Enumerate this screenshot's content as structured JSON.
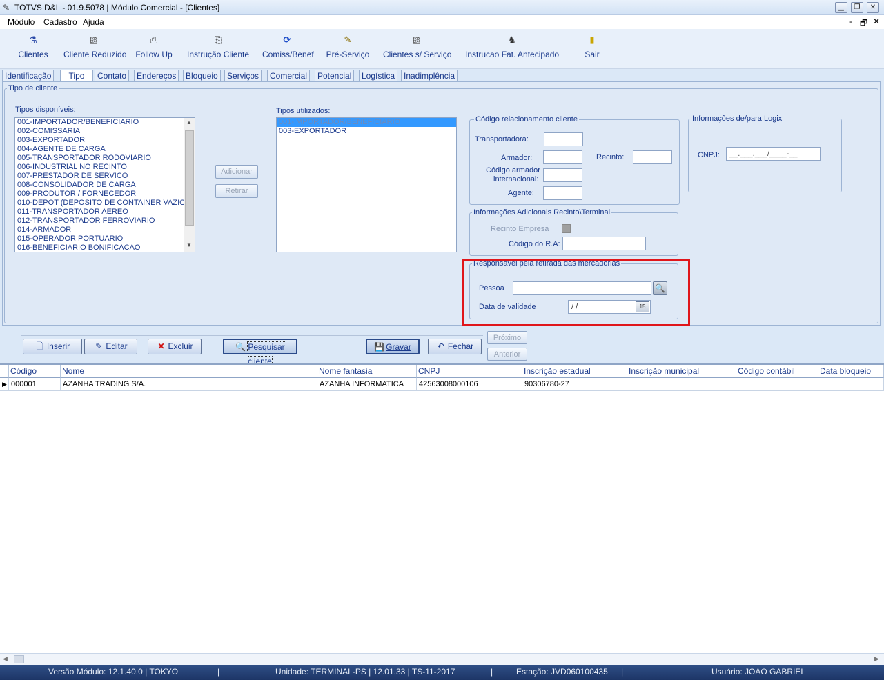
{
  "window": {
    "title": "TOTVS D&L - 01.9.5078 | Módulo Comercial - [Clientes]",
    "controls": {
      "minimize": "▁",
      "restore": "❐",
      "close": "✕"
    }
  },
  "menu": {
    "items": [
      "Módulo",
      "Cadastro",
      "Ajuda"
    ],
    "mdi_controls": {
      "minimize": "-",
      "restore": "🗗",
      "close": "✕"
    }
  },
  "toolbar": {
    "items": [
      {
        "label": "Clientes",
        "icon": "clients-icon",
        "glyph": "⚗"
      },
      {
        "label": "Cliente Reduzido",
        "icon": "reduced-client-icon",
        "glyph": "▧"
      },
      {
        "label": "Follow Up",
        "icon": "follow-up-icon",
        "glyph": "⎙"
      },
      {
        "label": "Instrução Cliente",
        "icon": "instruction-icon",
        "glyph": "⎘"
      },
      {
        "label": "Comiss/Benef",
        "icon": "refresh-icon",
        "glyph": "⟳"
      },
      {
        "label": "Pré-Serviço",
        "icon": "pre-service-icon",
        "glyph": "✎"
      },
      {
        "label": "Clientes s/ Serviço",
        "icon": "no-service-icon",
        "glyph": "▧"
      },
      {
        "label": "Instrucao Fat. Antecipado",
        "icon": "advance-billing-icon",
        "glyph": "♞"
      },
      {
        "label": "Sair",
        "icon": "exit-icon",
        "glyph": "▮"
      }
    ]
  },
  "tabs": [
    "Identificação",
    "Tipo",
    "Contato",
    "Endereços",
    "Bloqueio",
    "Serviços",
    "Comercial",
    "Potencial",
    "Logística",
    "Inadimplência"
  ],
  "active_tab": "Tipo",
  "tipo_cliente": {
    "legend": "Tipo de cliente",
    "available_label": "Tipos disponíveis:",
    "available": [
      "001-IMPORTADOR/BENEFICIARIO",
      "002-COMISSARIA",
      "003-EXPORTADOR",
      "004-AGENTE DE CARGA",
      "005-TRANSPORTADOR RODOVIARIO",
      "006-INDUSTRIAL NO RECINTO",
      "007-PRESTADOR DE SERVICO",
      "008-CONSOLIDADOR DE CARGA",
      "009-PRODUTOR / FORNECEDOR",
      "010-DEPOT (DEPOSITO DE CONTAINER VAZIO)",
      "011-TRANSPORTADOR AEREO",
      "012-TRANSPORTADOR FERROVIARIO",
      "014-ARMADOR",
      "015-OPERADOR PORTUARIO",
      "016-BENEFICIARIO BONIFICACAO"
    ],
    "add_button": "Adicionar",
    "remove_button": "Retirar",
    "used_label": "Tipos utilizados:",
    "used": [
      "001-IMPORTADOR/BENEFICIARIO",
      "003-EXPORTADOR"
    ]
  },
  "codigo_relacionamento": {
    "legend": "Código relacionamento cliente",
    "transportadora": "Transportadora:",
    "armador": "Armador:",
    "recinto": "Recinto:",
    "codigo_armador_1": "Código armador",
    "codigo_armador_2": "internacional:",
    "agente": "Agente:"
  },
  "logix": {
    "legend": "Informações de/para Logix",
    "cnpj_label": "CNPJ:",
    "cnpj_mask": "__.___.___/____-__"
  },
  "recinto_terminal": {
    "legend": "Informações Adicionais Recinto\\Terminal",
    "recinto_empresa": "Recinto Empresa",
    "codigo_ra": "Código do R.A:"
  },
  "responsavel": {
    "legend": "Responsável pela retirada das mercadorias",
    "pessoa_label": "Pessoa",
    "data_label": "Data de validade",
    "data_value": " / /",
    "calendar_glyph": "15",
    "highlight_color": "#e0161b"
  },
  "actions": {
    "inserir": "Inserir",
    "editar": "Editar",
    "excluir": "Excluir",
    "pesquisar": "Pesquisar cliente",
    "gravar": "Gravar",
    "fechar": "Fechar",
    "proximo": "Próximo",
    "anterior": "Anterior"
  },
  "grid": {
    "columns": [
      "Código",
      "Nome",
      "Nome fantasia",
      "CNPJ",
      "Inscrição estadual",
      "Inscrição municipal",
      "Código contábil",
      "Data bloqueio"
    ],
    "rows": [
      [
        "000001",
        "AZANHA TRADING S/A.",
        "AZANHA INFORMATICA",
        "42563008000106",
        "90306780-27",
        "",
        "",
        ""
      ]
    ]
  },
  "status": {
    "versao": "Versão Módulo:  12.1.40.0  |  TOKYO",
    "unidade": "Unidade: TERMINAL-PS | 12.01.33 | TS-11-2017",
    "estacao": "Estação: JVD060100435",
    "usuario": "Usuário: JOAO GABRIEL",
    "sep": "|"
  }
}
